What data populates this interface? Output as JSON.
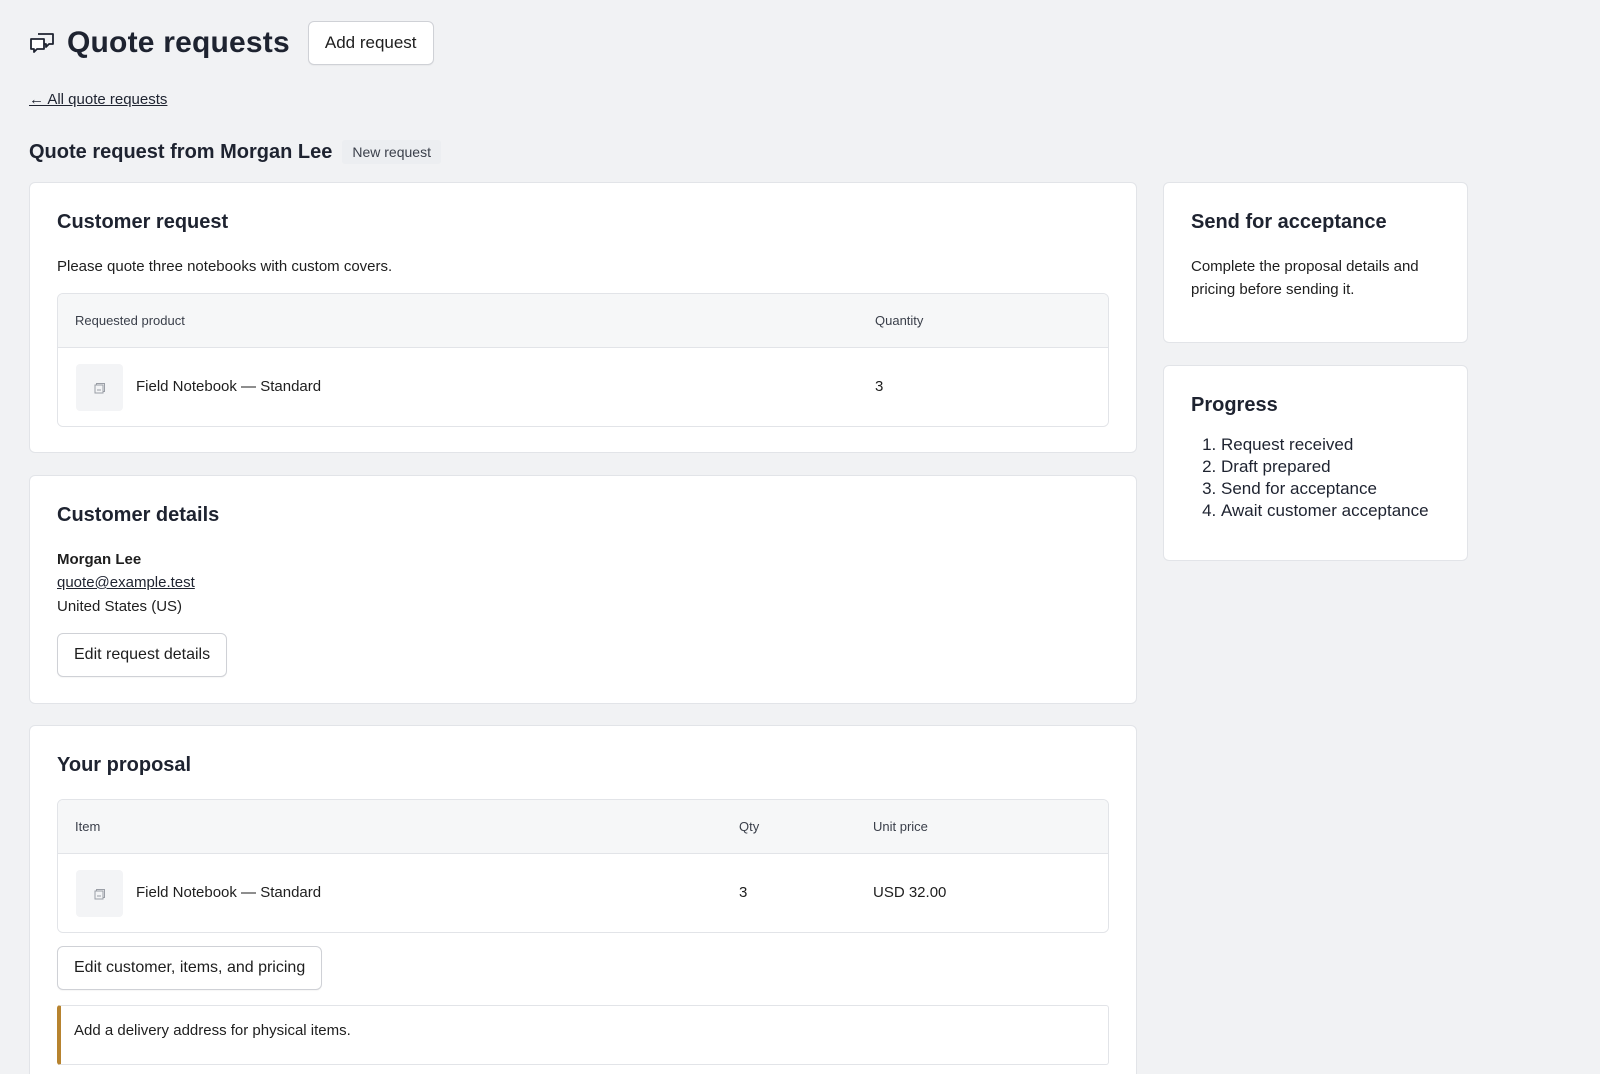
{
  "header": {
    "title": "Quote requests",
    "icon": "quote-requests-icon",
    "add_request_label": "Add request"
  },
  "back_link": "← All quote requests",
  "subheader": {
    "title": "Quote request from Morgan Lee",
    "status": "New request"
  },
  "customer_request": {
    "title": "Customer request",
    "message": "Please quote three notebooks with custom covers.",
    "table": {
      "columns": [
        "Requested product",
        "Quantity"
      ],
      "rows": [
        {
          "product": "Field Notebook — Standard",
          "quantity": "3"
        }
      ]
    }
  },
  "customer_details": {
    "title": "Customer details",
    "name": "Morgan Lee",
    "email": "quote@example.test",
    "country": "United States (US)",
    "edit_label": "Edit request details"
  },
  "proposal": {
    "title": "Your proposal",
    "table": {
      "columns": [
        "Item",
        "Qty",
        "Unit price"
      ],
      "rows": [
        {
          "item": "Field Notebook — Standard",
          "qty": "3",
          "unit_price": "USD 32.00"
        }
      ]
    },
    "edit_label": "Edit customer, items, and pricing",
    "notice": "Add a delivery address for physical items.",
    "notice_color": "#b7832f"
  },
  "send_for_acceptance": {
    "title": "Send for acceptance",
    "text": "Complete the proposal details and pricing before sending it."
  },
  "progress": {
    "title": "Progress",
    "steps": [
      "Request received",
      "Draft prepared",
      "Send for acceptance",
      "Await customer acceptance"
    ]
  }
}
